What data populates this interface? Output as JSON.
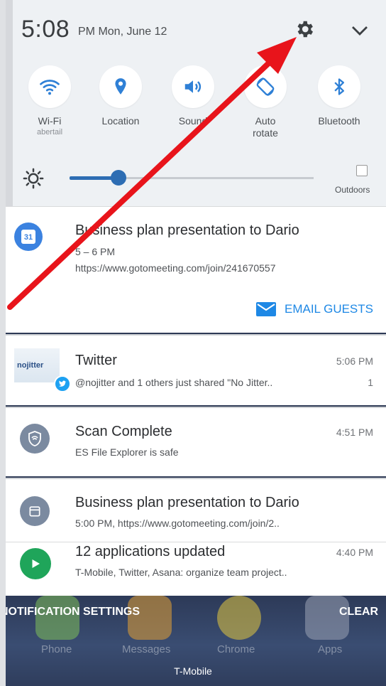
{
  "status": {
    "time": "5:08",
    "ampm_date": "PM  Mon, June 12"
  },
  "icons": {
    "settings": "gear-icon",
    "expand": "chevron-down-icon",
    "brightness": "sun-icon"
  },
  "quick_settings": [
    {
      "label": "Wi-Fi",
      "sub": "abertail",
      "icon": "wifi-icon"
    },
    {
      "label": "Location",
      "sub": "",
      "icon": "location-pin-icon"
    },
    {
      "label": "Sound",
      "sub": "",
      "icon": "speaker-icon"
    },
    {
      "label": "Auto",
      "label2": "rotate",
      "icon": "rotate-icon"
    },
    {
      "label": "Bluetooth",
      "sub": "",
      "icon": "bluetooth-icon"
    }
  ],
  "brightness": {
    "level": 0.2,
    "outdoors_label": "Outdoors"
  },
  "notifications": {
    "calendar": {
      "title": "Business plan presentation to Dario",
      "time_range": "5 – 6 PM",
      "link": "https://www.gotomeeting.com/join/241670557",
      "action": "EMAIL GUESTS",
      "icon_text": "31"
    },
    "twitter": {
      "title": "Twitter",
      "time": "5:06 PM",
      "text": "@nojitter and 1 others just shared \"No Jitter..",
      "count": "1",
      "thumb_text": "nojitter"
    },
    "scan": {
      "title": "Scan Complete",
      "time": "4:51 PM",
      "text": "ES File Explorer is safe"
    },
    "calendar2": {
      "title": "Business plan presentation to Dario",
      "text": "5:00 PM, https://www.gotomeeting.com/join/2.."
    },
    "updates": {
      "title": "12 applications updated",
      "time": "4:40 PM",
      "text": "T-Mobile, Twitter, Asana: organize team project.."
    }
  },
  "footer": {
    "settings_label": "NOTIFICATION SETTINGS",
    "clear_label": "CLEAR",
    "dock": [
      "Phone",
      "Messages",
      "Chrome",
      "Apps"
    ],
    "carrier": "T-Mobile"
  },
  "colors": {
    "accent": "#1e88e5",
    "arrow": "#e8141b",
    "calendar_blue": "#3b82e0",
    "update_green": "#1fa55a"
  }
}
